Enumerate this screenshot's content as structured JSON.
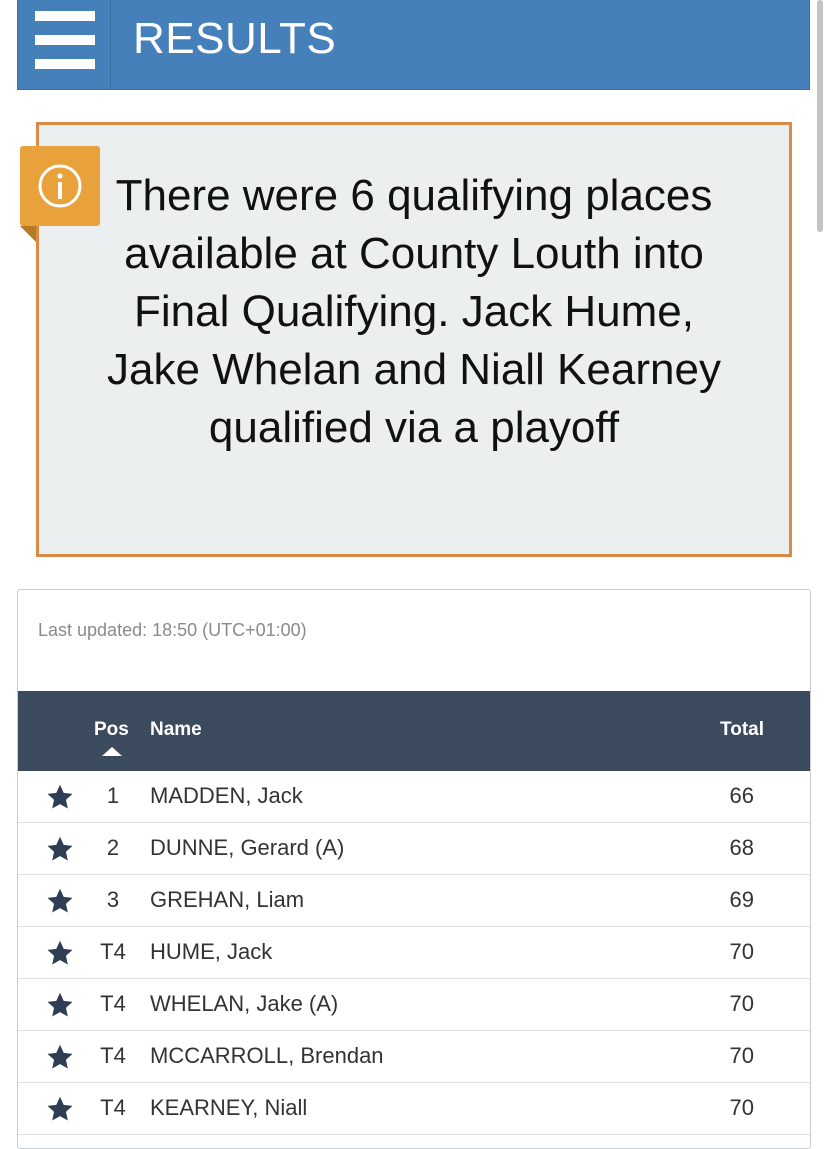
{
  "header": {
    "title": "RESULTS"
  },
  "notice": {
    "text": "There were 6 qualifying places available at County Louth into Final Qualifying. Jack Hume, Jake Whelan and Niall Kearney qualified via a playoff",
    "icon": "info-icon",
    "border_color": "#d98a45",
    "badge_color": "#e9a23b"
  },
  "results": {
    "last_updated": "Last updated: 18:50 (UTC+01:00)",
    "columns": {
      "pos": "Pos",
      "name": "Name",
      "total": "Total"
    },
    "rows": [
      {
        "pos": "1",
        "name": "MADDEN, Jack",
        "total": "66"
      },
      {
        "pos": "2",
        "name": "DUNNE, Gerard (A)",
        "total": "68"
      },
      {
        "pos": "3",
        "name": "GREHAN, Liam",
        "total": "69"
      },
      {
        "pos": "T4",
        "name": "HUME, Jack",
        "total": "70"
      },
      {
        "pos": "T4",
        "name": "WHELAN, Jake (A)",
        "total": "70"
      },
      {
        "pos": "T4",
        "name": "MCCARROLL, Brendan",
        "total": "70"
      },
      {
        "pos": "T4",
        "name": "KEARNEY, Niall",
        "total": "70"
      }
    ]
  },
  "colors": {
    "header_bg": "#4580bb",
    "table_header_bg": "#3c4a5e",
    "star": "#2f3e55"
  }
}
